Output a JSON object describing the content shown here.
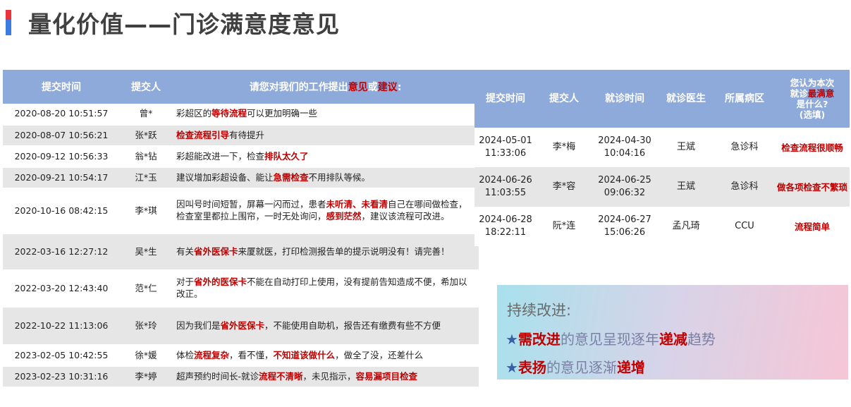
{
  "page": {
    "title": "量化价值——门诊满意度意见"
  },
  "left_table": {
    "headers": {
      "time": "提交时间",
      "submitter": "提交人",
      "suggest_prefix": "请您对我们的工作提出",
      "suggest_opinion": "意见",
      "suggest_or": "或",
      "suggest_advice": "建议",
      "suggest_colon": ":"
    },
    "rows": [
      {
        "time": "2020-08-20 10:51:57",
        "name": "曾*",
        "parts": [
          {
            "t": "彩超区的"
          },
          {
            "t": "等待流程",
            "h": true
          },
          {
            "t": "可以更加明确一些"
          }
        ]
      },
      {
        "time": "2020-08-07 10:56:21",
        "name": "张*跃",
        "parts": [
          {
            "t": "检查流程引导",
            "h": true
          },
          {
            "t": "有待提升"
          }
        ]
      },
      {
        "time": "2020-09-12 10:56:33",
        "name": "翁*钻",
        "parts": [
          {
            "t": "彩超能改进一下，检查"
          },
          {
            "t": "排队太久了",
            "h": true
          }
        ]
      },
      {
        "time": "2020-09-21 10:54:17",
        "name": "江*玉",
        "parts": [
          {
            "t": "建议增加彩超设备、能让"
          },
          {
            "t": "急需检查",
            "h": true
          },
          {
            "t": "不用排队等候。"
          }
        ]
      },
      {
        "time": "2020-10-16 08:42:15",
        "name": "李*琪",
        "parts": [
          {
            "t": "因叫号时间短暂，屏幕一闪而过，患者"
          },
          {
            "t": "未听清、未看清",
            "h": true
          },
          {
            "t": "自己在哪间做检查，检查室里都拉上围帘，一时无处询问，"
          },
          {
            "t": "感到茫然",
            "h": true
          },
          {
            "t": "，建议该流程可改进。"
          }
        ]
      },
      {
        "time": "2022-03-16 12:27:12",
        "name": "吴*生",
        "parts": [
          {
            "t": "有关"
          },
          {
            "t": "省外医保卡",
            "h": true
          },
          {
            "t": "来厦就医，打印检测报告单的提示说明没有！请完善！"
          }
        ]
      },
      {
        "time": "2022-03-20 12:43:40",
        "name": "范*仁",
        "parts": [
          {
            "t": "对于"
          },
          {
            "t": "省外的医保卡",
            "h": true
          },
          {
            "t": "不能在自动打印上使用，没有提前告知造成不便，希加以改正。"
          }
        ]
      },
      {
        "time": "2022-10-22 11:13:06",
        "name": "张*玲",
        "parts": [
          {
            "t": "因为我们是"
          },
          {
            "t": "省外医保卡",
            "h": true
          },
          {
            "t": "，不能使用自助机，报告还有缴费有些不方便"
          }
        ]
      },
      {
        "time": "2023-02-05 10:42:55",
        "name": "徐*媛",
        "parts": [
          {
            "t": "体检"
          },
          {
            "t": "流程复杂",
            "h": true
          },
          {
            "t": "，看不懂，"
          },
          {
            "t": "不知道该做什么",
            "h": true
          },
          {
            "t": "，做全了没，还差什么"
          }
        ]
      },
      {
        "time": "2023-02-23 10:31:16",
        "name": "李*婷",
        "parts": [
          {
            "t": "超声预约时间长-就诊"
          },
          {
            "t": "流程不清晰",
            "h": true
          },
          {
            "t": "，未见指示，"
          },
          {
            "t": "容易漏项目检查",
            "h": true
          }
        ]
      }
    ]
  },
  "right_table": {
    "headers": {
      "submit_time": "提交时间",
      "submitter": "提交人",
      "visit_time": "就诊时间",
      "doctor": "就诊医生",
      "ward": "所属病区",
      "q_part1": "您认为本次",
      "q_part2": "就诊",
      "q_part3": "最满意",
      "q_part4": "是什么?",
      "q_part5": "(选填)"
    },
    "rows": [
      {
        "submit_date": "2024-05-01",
        "submit_clock": "11:33:06",
        "name": "李*梅",
        "visit_date": "2024-04-30",
        "visit_clock": "10:04:16",
        "doctor": "王斌",
        "ward": "急诊科",
        "answer": "检查流程很顺畅"
      },
      {
        "submit_date": "2024-06-26",
        "submit_clock": "11:03:55",
        "name": "李*容",
        "visit_date": "2024-06-25",
        "visit_clock": "09:06:32",
        "doctor": "王斌",
        "ward": "急诊科",
        "answer": "做各项检查不繁琐"
      },
      {
        "submit_date": "2024-06-28",
        "submit_clock": "18:22:11",
        "name": "阮*连",
        "visit_date": "2024-06-27",
        "visit_clock": "15:06:26",
        "doctor": "孟凡琦",
        "ward": "CCU",
        "answer": "流程简单"
      }
    ]
  },
  "improvement": {
    "title": "持续改进:",
    "line1": {
      "star": "★",
      "red1": "需改进",
      "mid1": "的意见呈现逐年",
      "red2": "递减",
      "end": "趋势"
    },
    "line2": {
      "star": "★",
      "red1": "表扬",
      "mid1": "的意见逐渐",
      "red2": "递增"
    }
  },
  "colors": {
    "header_bg": "#8eaadb",
    "highlight": "#c00000",
    "row_alt": "#e6e6e6",
    "accent_red": "#e8343a",
    "accent_blue": "#3a7ce0"
  }
}
